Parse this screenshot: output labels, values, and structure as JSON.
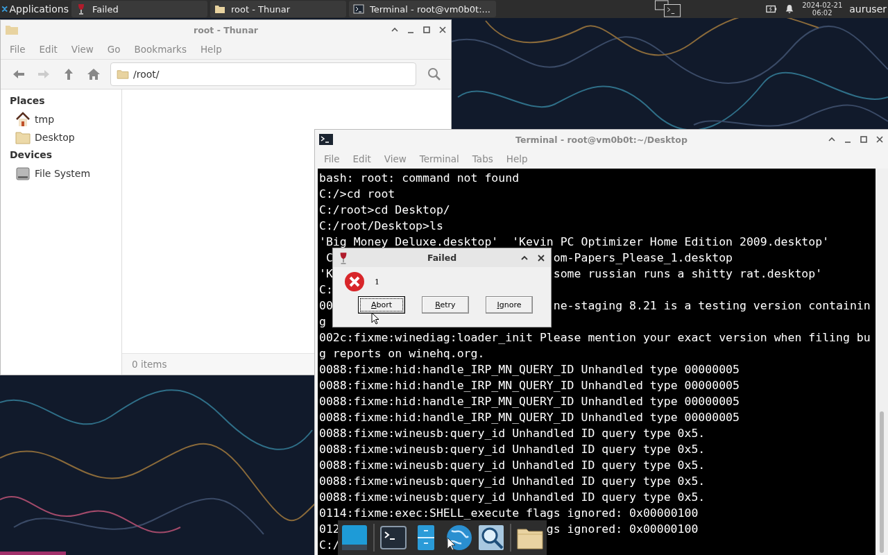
{
  "top_panel": {
    "apps_menu": "Applications",
    "tasks": [
      {
        "label": "Failed",
        "kind": "wine"
      },
      {
        "label": "root - Thunar",
        "kind": "folder"
      },
      {
        "label": "Terminal - root@vm0b0t:...",
        "kind": "terminal"
      }
    ],
    "date": "2024-02-21",
    "time": "06:02",
    "user": "auruser"
  },
  "thunar": {
    "title": "root - Thunar",
    "menu": [
      "File",
      "Edit",
      "View",
      "Go",
      "Bookmarks",
      "Help"
    ],
    "location": "/root/",
    "sidebar": [
      {
        "heading": "Places",
        "items": [
          {
            "label": "tmp",
            "kind": "home"
          },
          {
            "label": "Desktop",
            "kind": "folder"
          }
        ]
      },
      {
        "heading": "Devices",
        "items": [
          {
            "label": "File System",
            "kind": "drive"
          }
        ]
      }
    ],
    "status": "0 items"
  },
  "terminal": {
    "title": "Terminal - root@vm0b0t:~/Desktop",
    "menu": [
      "File",
      "Edit",
      "View",
      "Terminal",
      "Tabs",
      "Help"
    ],
    "lines": [
      {
        "text": "bash: root: command not found"
      },
      {
        "text": "C:/>cd root"
      },
      {
        "text": "C:/root>cd Desktop/"
      },
      {
        "text": "C:/root/Desktop>ls"
      },
      {
        "text": "'Big Money Deluxe.desktop'  'Kevin PC Optimizer Home Edition 2009.desktop'"
      },
      {
        "text": " C",
        "tail": "om-Papers_Please_1.desktop",
        "kind": "dialog"
      },
      {
        "text": "'K",
        "tail": "some russian runs a shitty rat.desktop'",
        "kind": "dialog"
      },
      {
        "text": "C:"
      },
      {
        "text": "00",
        "tail": "ne-staging 8.21 is a testing version containin",
        "kind": "dialog"
      },
      {
        "text": "g"
      },
      {
        "text": "002c:fixme:winediag:loader_init Please mention your exact version when filing bu"
      },
      {
        "text": "g reports on winehq.org."
      },
      {
        "text": "0088:fixme:hid:handle_IRP_MN_QUERY_ID Unhandled type 00000005"
      },
      {
        "text": "0088:fixme:hid:handle_IRP_MN_QUERY_ID Unhandled type 00000005"
      },
      {
        "text": "0088:fixme:hid:handle_IRP_MN_QUERY_ID Unhandled type 00000005"
      },
      {
        "text": "0088:fixme:hid:handle_IRP_MN_QUERY_ID Unhandled type 00000005"
      },
      {
        "text": "0088:fixme:wineusb:query_id Unhandled ID query type 0x5."
      },
      {
        "text": "0088:fixme:wineusb:query_id Unhandled ID query type 0x5."
      },
      {
        "text": "0088:fixme:wineusb:query_id Unhandled ID query type 0x5."
      },
      {
        "text": "0088:fixme:wineusb:query_id Unhandled ID query type 0x5."
      },
      {
        "text": "0088:fixme:wineusb:query_id Unhandled ID query type 0x5."
      },
      {
        "text": "0114:fixme:exec:SHELL_execute flags ignored: 0x00000100"
      },
      {
        "text": "012",
        "tail": "gs ignored: 0x00000100",
        "kind": "dock"
      },
      {
        "text": "C:/"
      }
    ]
  },
  "dialog": {
    "title": "Failed",
    "message": "1",
    "buttons": [
      {
        "label": "Abort",
        "selected": true
      },
      {
        "label": "Retry",
        "selected": false
      },
      {
        "label": "Ignore",
        "selected": false
      }
    ]
  }
}
